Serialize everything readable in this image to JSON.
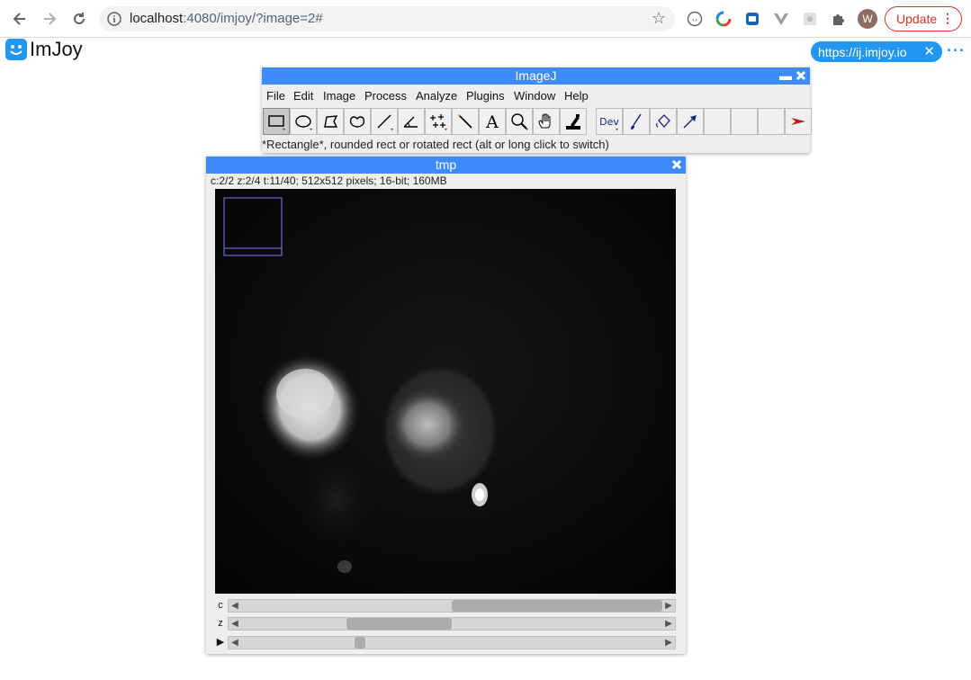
{
  "browser": {
    "url_host": "localhost",
    "url_rest": ":4080/imjoy/?image=2#",
    "avatar_letter": "W",
    "update_label": "Update"
  },
  "imjoy": {
    "title": "ImJoy",
    "url_chip": "https://ij.imjoy.io",
    "accent": "#2196f3"
  },
  "imagej": {
    "title": "ImageJ",
    "menu": [
      "File",
      "Edit",
      "Image",
      "Process",
      "Analyze",
      "Plugins",
      "Window",
      "Help"
    ],
    "tools": [
      {
        "name": "rectangle-tool-icon",
        "active": true
      },
      {
        "name": "oval-tool-icon"
      },
      {
        "name": "polygon-tool-icon"
      },
      {
        "name": "freehand-tool-icon"
      },
      {
        "name": "line-tool-icon"
      },
      {
        "name": "angle-tool-icon"
      },
      {
        "name": "multipoint-tool-icon"
      },
      {
        "name": "wand-tool-icon"
      },
      {
        "name": "text-tool-icon",
        "glyph": "A"
      },
      {
        "name": "magnifier-tool-icon"
      },
      {
        "name": "hand-tool-icon"
      },
      {
        "name": "color-picker-tool-icon"
      },
      {
        "name": "dev-tool-icon",
        "glyph": "Dev"
      },
      {
        "name": "brush-tool-icon"
      },
      {
        "name": "flood-fill-tool-icon"
      },
      {
        "name": "arrow-tool-icon"
      },
      {
        "name": "empty-tool-slot-1"
      },
      {
        "name": "empty-tool-slot-2"
      },
      {
        "name": "empty-tool-slot-3"
      },
      {
        "name": "more-tools-arrow-icon",
        "glyph": "➤"
      }
    ],
    "status": "*Rectangle*, rounded rect or rotated rect (alt or long click to switch)",
    "titlebar_color": "#3d8bfd"
  },
  "image_window": {
    "title": "tmp",
    "info": "c:2/2 z:2/4 t:11/40; 512x512 pixels; 16-bit; 160MB",
    "sliders": [
      {
        "label": "c",
        "position": 0.5,
        "thumb_fraction": 0.5
      },
      {
        "label": "z",
        "position": 0.25,
        "thumb_fraction": 0.25
      },
      {
        "label": "",
        "position": 0.27,
        "thumb_fraction": 0.025
      }
    ]
  }
}
